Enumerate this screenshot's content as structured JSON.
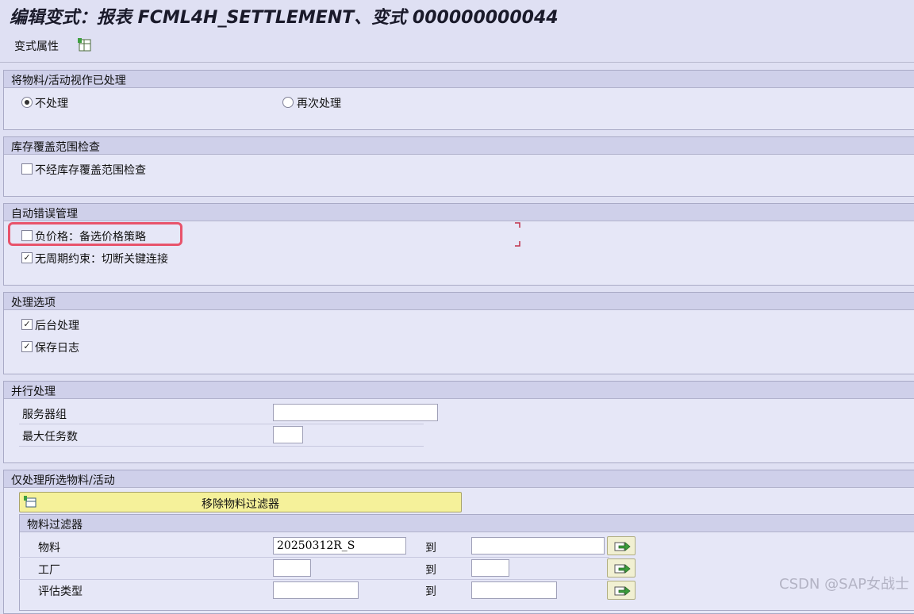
{
  "window": {
    "title": "编辑变式：报表 FCML4H_SETTLEMENT、变式 000000000044"
  },
  "toolbar": {
    "variant_attr": "变式属性"
  },
  "groups": {
    "processed": {
      "title": "将物料/活动视作已处理",
      "opt_none": "不处理",
      "opt_reprocess": "再次处理",
      "selected": "不处理"
    },
    "stock": {
      "title": "库存覆盖范围检查",
      "no_check": "不经库存覆盖范围检查",
      "no_check_checked": false
    },
    "auto_error": {
      "title": "自动错误管理",
      "neg_price": "负价格：备选价格策略",
      "neg_price_checked": false,
      "no_cycle": "无周期约束：切断关键连接",
      "no_cycle_checked": true
    },
    "processing": {
      "title": "处理选项",
      "background": "后台处理",
      "background_checked": true,
      "save_log": "保存日志",
      "save_log_checked": true
    },
    "parallel": {
      "title": "并行处理",
      "server_group": "服务器组",
      "server_group_value": "",
      "max_tasks": "最大任务数",
      "max_tasks_value": ""
    },
    "selection": {
      "title": "仅处理所选物料/活动",
      "remove_filter": "移除物料过滤器",
      "filter_title": "物料过滤器",
      "to_label": "到",
      "rows": [
        {
          "label": "物料",
          "from": "20250312R_S",
          "to": ""
        },
        {
          "label": "工厂",
          "from": "",
          "to": ""
        },
        {
          "label": "评估类型",
          "from": "",
          "to": ""
        }
      ]
    }
  },
  "watermark": "CSDN @SAP女战士",
  "check_mark": "✓",
  "colors": {
    "background": "#dfe0f3",
    "highlight": "#e8536b",
    "button_yellow": "#f5f19a"
  }
}
